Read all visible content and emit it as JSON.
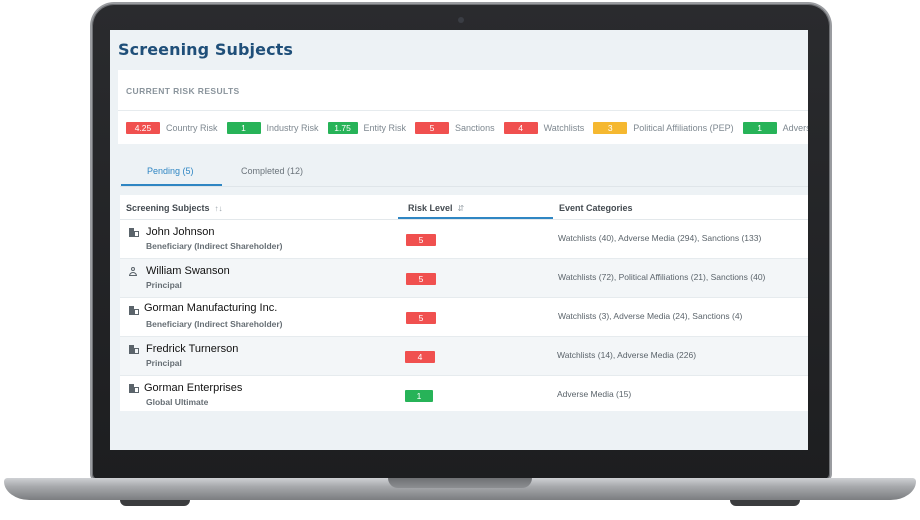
{
  "colors": {
    "red": "#f0504f",
    "green": "#27b358",
    "yellow": "#f5b830",
    "title_blue": "#1f4f79",
    "accent_blue": "#2f86c3"
  },
  "page": {
    "title": "Screening Subjects"
  },
  "risk_results": {
    "heading": "CURRENT RISK RESULTS",
    "items": [
      {
        "value": "4.25",
        "label": "Country Risk",
        "color": "red"
      },
      {
        "value": "1",
        "label": "Industry Risk",
        "color": "green"
      },
      {
        "value": "1.75",
        "label": "Entity Risk",
        "color": "green"
      },
      {
        "value": "5",
        "label": "Sanctions",
        "color": "red"
      },
      {
        "value": "4",
        "label": "Watchlists",
        "color": "red"
      },
      {
        "value": "3",
        "label": "Political Affiliations (PEP)",
        "color": "yellow"
      },
      {
        "value": "1",
        "label": "Adverse media",
        "color": "green"
      }
    ]
  },
  "tabs": [
    {
      "label": "Pending (5)",
      "active": true
    },
    {
      "label": "Completed (12)",
      "active": false
    }
  ],
  "table": {
    "columns": [
      "Screening Subjects",
      "Risk Level",
      "Event Categories"
    ],
    "rows": [
      {
        "icon": "building-icon",
        "name": "John Johnson",
        "role": "Beneficiary (Indirect Shareholder)",
        "risk": "5",
        "risk_color": "red",
        "events": "Watchlists (40), Adverse Media (294), Sanctions (133)"
      },
      {
        "icon": "person-icon",
        "name": "William Swanson",
        "role": "Principal",
        "risk": "5",
        "risk_color": "red",
        "events": "Watchlists (72), Political Affiliations (21), Sanctions (40)"
      },
      {
        "icon": "building-icon",
        "name": "Gorman Manufacturing Inc.",
        "role": "Beneficiary (Indirect Shareholder)",
        "risk": "5",
        "risk_color": "red",
        "events": "Watchlists (3), Adverse Media (24), Sanctions (4)"
      },
      {
        "icon": "building-icon",
        "name": "Fredrick Turnerson",
        "role": "Principal",
        "risk": "4",
        "risk_color": "red",
        "events": "Watchlists (14), Adverse Media (226)"
      },
      {
        "icon": "building-icon",
        "name": "Gorman Enterprises",
        "role": "Global Ultimate",
        "risk": "1",
        "risk_color": "green",
        "events": "Adverse Media (15)"
      }
    ]
  }
}
